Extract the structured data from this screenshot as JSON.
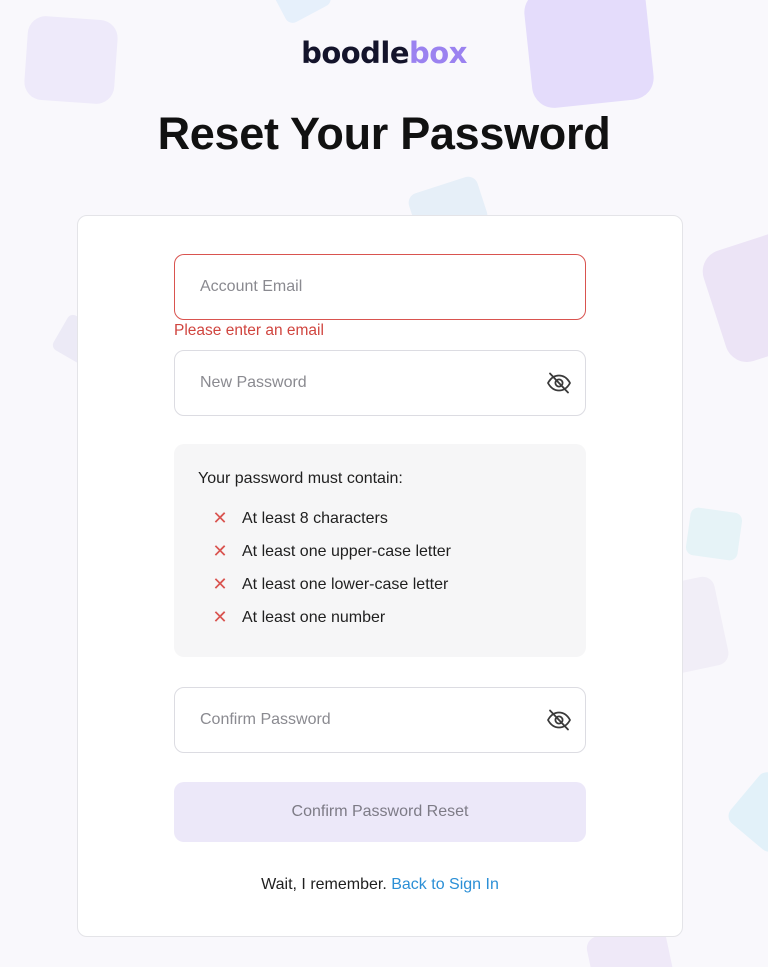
{
  "brand": {
    "logo_text_main": "boodle",
    "logo_text_accent": "box",
    "accent_color": "#9b82f0"
  },
  "page": {
    "title": "Reset Your Password"
  },
  "form": {
    "email": {
      "placeholder": "Account Email",
      "value": "",
      "error": "Please enter an email",
      "error_color": "#d0453f"
    },
    "new_password": {
      "placeholder": "New Password",
      "value": "",
      "toggle_icon": "eye-slash-icon"
    },
    "requirements": {
      "title": "Your password must contain:",
      "status_icon": "x-mark-icon",
      "items": [
        "At least 8 characters",
        "At least one upper-case letter",
        "At least one lower-case letter",
        "At least one number"
      ]
    },
    "confirm_password": {
      "placeholder": "Confirm Password",
      "value": "",
      "toggle_icon": "eye-slash-icon"
    },
    "submit_label": "Confirm Password Reset"
  },
  "footer": {
    "prompt": "Wait, I remember.",
    "link_label": "Back to Sign In",
    "link_color": "#2b8fd6"
  }
}
